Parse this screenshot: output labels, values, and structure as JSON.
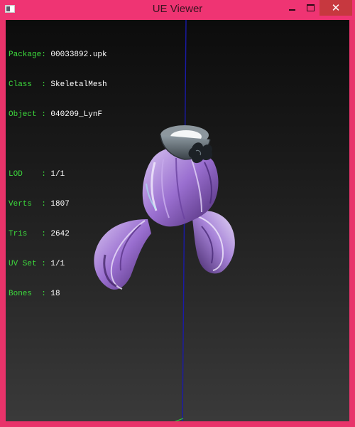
{
  "window": {
    "title": "UE Viewer",
    "close_glyph": "✕",
    "icons": [
      "app-icon",
      "minimize-icon",
      "maximize-icon",
      "close-icon"
    ],
    "colors": {
      "frame": "#ef3473",
      "close_button": "#c7383f",
      "label_text": "#3ddc3d",
      "value_text": "#ffffff",
      "axis_line": "#1a1aa8"
    }
  },
  "info": {
    "rows": [
      {
        "label": "Package:",
        "value": "00033892.upk"
      },
      {
        "label": "Class  :",
        "value": "SkeletalMesh"
      },
      {
        "label": "Object :",
        "value": "040209_LynF"
      },
      {
        "label": "LOD    :",
        "value": "1/1"
      },
      {
        "label": "Verts  :",
        "value": "1807"
      },
      {
        "label": "Tris   :",
        "value": "2642"
      },
      {
        "label": "UV Set :",
        "value": "1/1"
      },
      {
        "label": "Bones  :",
        "value": "18"
      }
    ]
  }
}
